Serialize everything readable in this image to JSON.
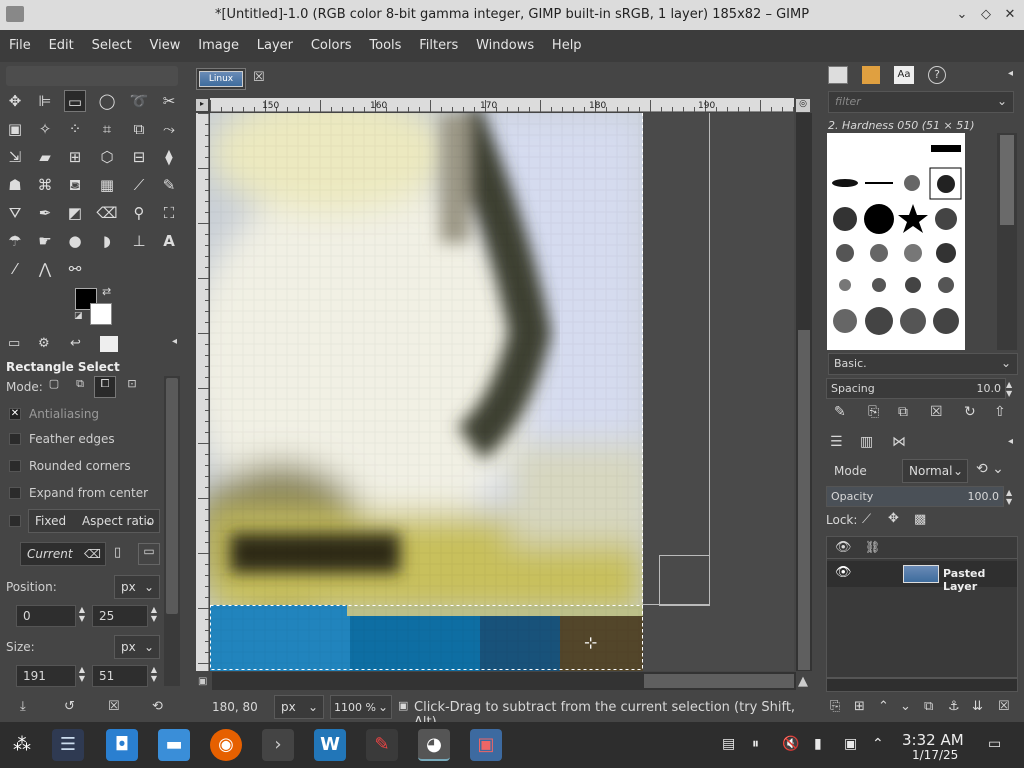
{
  "window": {
    "title": "*[Untitled]-1.0 (RGB color 8-bit gamma integer, GIMP built-in sRGB, 1 layer) 185x82 – GIMP"
  },
  "menu": [
    "File",
    "Edit",
    "Select",
    "View",
    "Image",
    "Layer",
    "Colors",
    "Tools",
    "Filters",
    "Windows",
    "Help"
  ],
  "tool_options": {
    "title": "Rectangle Select",
    "mode_label": "Mode:",
    "antialiasing": "Antialiasing",
    "feather": "Feather edges",
    "rounded": "Rounded corners",
    "expand": "Expand from center",
    "fixed": "Fixed",
    "fixed_option": "Aspect ratio",
    "current": "Current",
    "position_label": "Position:",
    "position_unit": "px",
    "pos_x": "0",
    "pos_y": "25",
    "size_label": "Size:",
    "size_unit": "px",
    "size_w": "191",
    "size_h": "51"
  },
  "ruler": {
    "h": [
      "150",
      "160",
      "170",
      "180",
      "190"
    ]
  },
  "status": {
    "coords": "180, 80",
    "unit": "px",
    "zoom": "1100 %",
    "message": "Click-Drag to subtract from the current selection (try Shift, Alt)"
  },
  "brushes": {
    "filter_placeholder": "filter",
    "current": "2. Hardness 050 (51 × 51)",
    "preset": "Basic.",
    "spacing_label": "Spacing",
    "spacing_value": "10.0"
  },
  "layers": {
    "mode_label": "Mode",
    "mode_value": "Normal",
    "opacity_label": "Opacity",
    "opacity_value": "100.0",
    "lock_label": "Lock:",
    "layer_name": "Pasted Layer"
  },
  "clock": {
    "time": "3:32 AM",
    "date": "1/17/25"
  },
  "image_tab": "Linux"
}
